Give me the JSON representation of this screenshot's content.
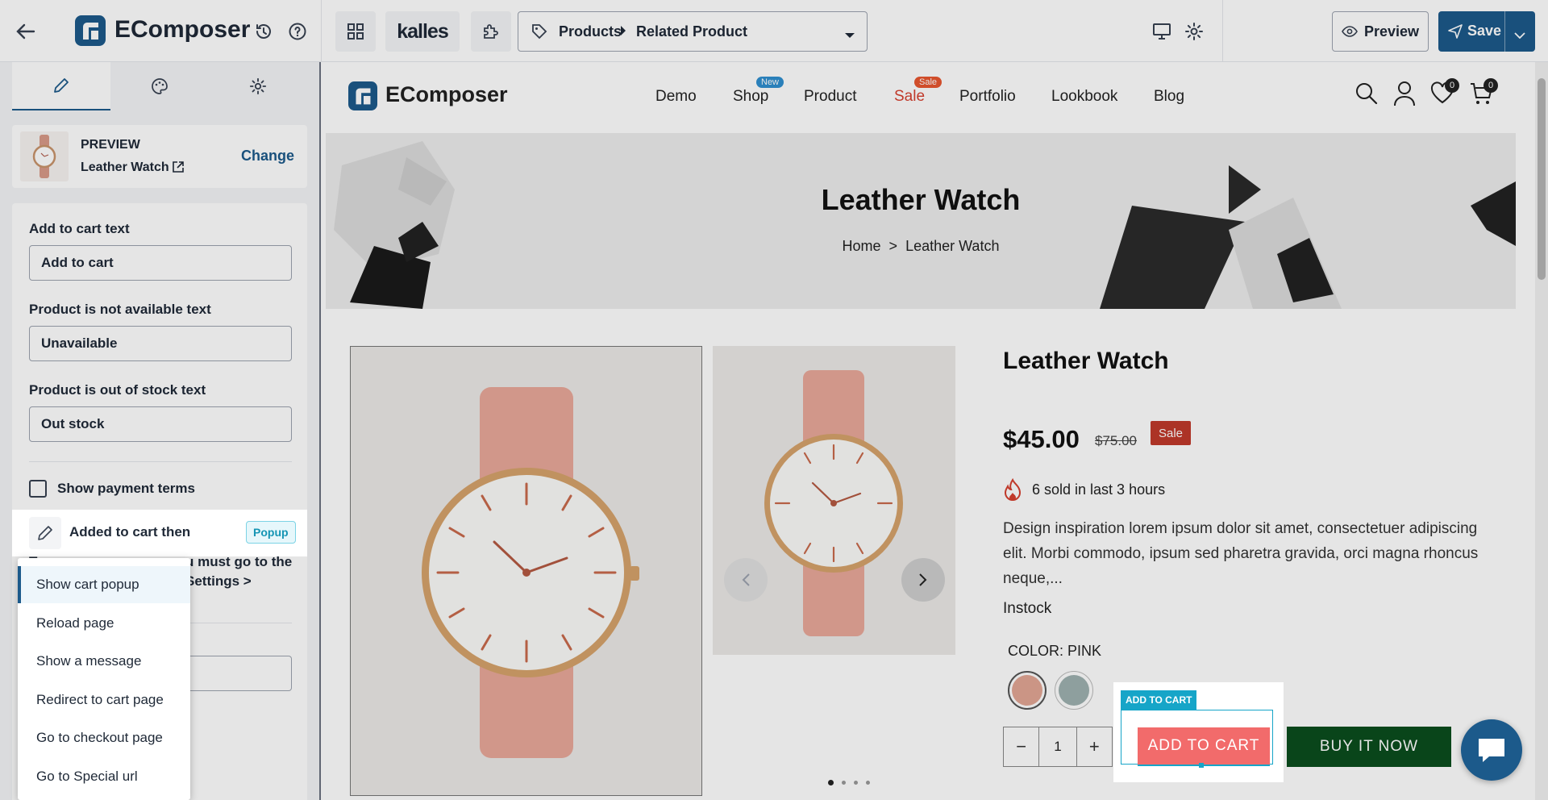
{
  "topbar": {
    "app_name": "EComposer",
    "theme_name": "kalles",
    "breadcrumb_root": "Products",
    "breadcrumb_page": "Related Product",
    "preview_label": "Preview",
    "save_label": "Save"
  },
  "sidebar": {
    "preview_caption": "PREVIEW",
    "product_name": "Leather Watch",
    "change_label": "Change",
    "add_to_cart_label": "Add to cart text",
    "add_to_cart_value": "Add to cart",
    "unavailable_label": "Product is not available text",
    "unavailable_value": "Unavailable",
    "out_of_stock_label": "Product is out of stock text",
    "out_of_stock_value": "Out stock",
    "payment_terms_label": "Show payment terms",
    "added_to_cart_label": "Added to cart then",
    "added_to_cart_value": "Popup",
    "hint_start": "T",
    "hint_mid": "u must go to the",
    "hint_end": "Settings >",
    "hint_link": "t"
  },
  "dropdown": {
    "options": [
      {
        "label": "Show cart popup",
        "selected": true
      },
      {
        "label": "Reload page",
        "selected": false
      },
      {
        "label": "Show a message",
        "selected": false
      },
      {
        "label": "Redirect to cart page",
        "selected": false
      },
      {
        "label": "Go to checkout page",
        "selected": false
      },
      {
        "label": "Go to Special url",
        "selected": false
      }
    ]
  },
  "store": {
    "logo": "EComposer",
    "nav": [
      "Demo",
      "Shop",
      "Product",
      "Sale",
      "Portfolio",
      "Lookbook",
      "Blog"
    ],
    "shop_badge": "New",
    "sale_badge": "Sale",
    "wishlist_count": "0",
    "cart_count": "0",
    "hero_title": "Leather Watch",
    "crumb_home": "Home",
    "crumb_sep": ">",
    "crumb_current": "Leather Watch"
  },
  "product": {
    "title": "Leather Watch",
    "price": "$45.00",
    "compare_price": "$75.00",
    "sale_badge": "Sale",
    "sold_text": "6 sold in last 3 hours",
    "description": "Design inspiration lorem ipsum dolor sit amet, consectetuer adipiscing elit. Morbi commodo, ipsum sed pharetra gravida, orci magna rhoncus neque,...",
    "stock": "Instock",
    "color_label": "COLOR: PINK",
    "quantity": "1",
    "add_to_cart": "ADD TO CART",
    "add_to_cart_tag": "ADD TO CART",
    "buy_now": "BUY IT NOW"
  },
  "colors": {
    "brand_blue": "#1c5a8b",
    "sale_red": "#c0392b",
    "add_to_cart_bg": "#f26b6b",
    "buy_now_bg": "#0b4d1e",
    "cyan": "#16a5c8"
  }
}
